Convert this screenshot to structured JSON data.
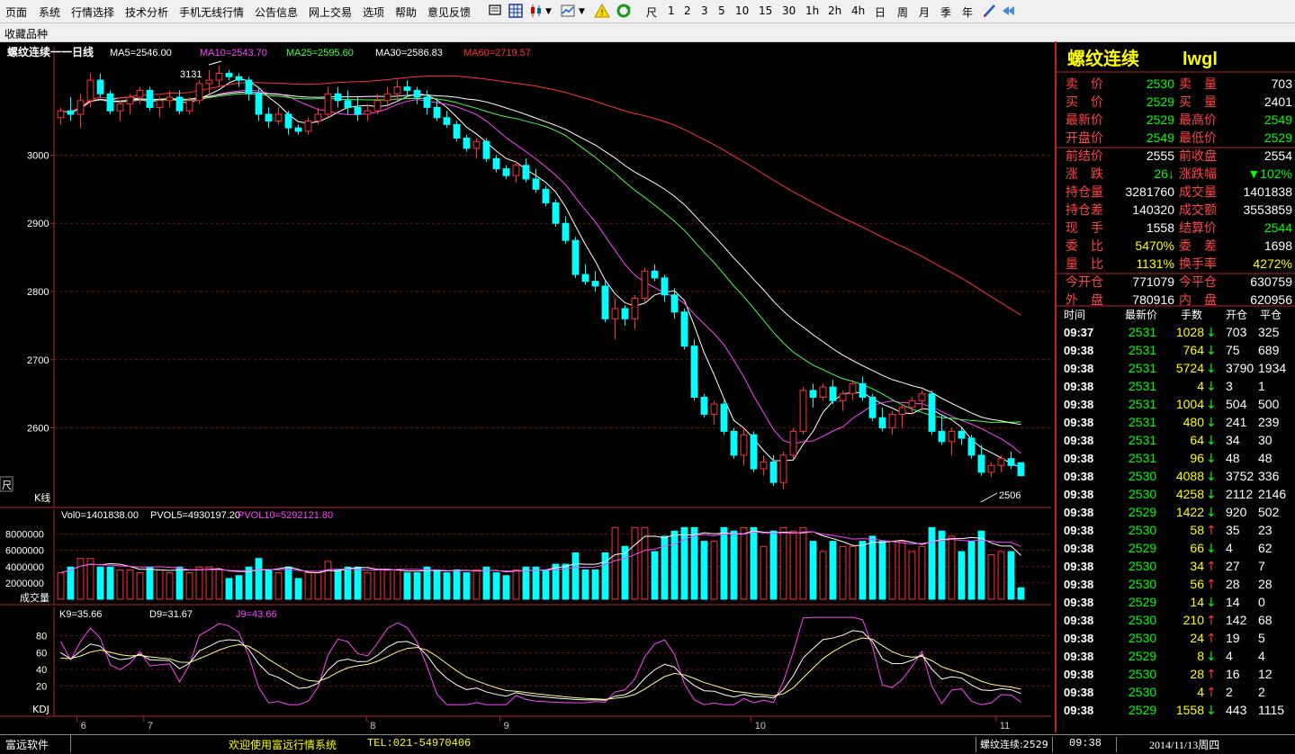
{
  "menu": [
    "页面",
    "系统",
    "行情选择",
    "技术分析",
    "手机无线行情",
    "公告信息",
    "网上交易",
    "选项",
    "帮助",
    "意见反馈"
  ],
  "toolbar": {
    "periods": [
      "尺",
      "1",
      "2",
      "3",
      "5",
      "10",
      "15",
      "30",
      "1h",
      "2h",
      "4h",
      "日",
      "周",
      "月",
      "季",
      "年"
    ]
  },
  "favorites_label": "收藏品种",
  "chart": {
    "title": "螺纹连续一一日线",
    "ma_labels": [
      {
        "text": "MA5=2546.00",
        "color": "#ffffff"
      },
      {
        "text": "MA10=2543.70",
        "color": "#ff44ff"
      },
      {
        "text": "MA25=2595.60",
        "color": "#44ff44"
      },
      {
        "text": "MA30=2586.83",
        "color": "#ffffff"
      },
      {
        "text": "MA60=2719.57",
        "color": "#ff3333"
      }
    ],
    "price_axis": [
      "3000",
      "2900",
      "2800",
      "2700",
      "2600"
    ],
    "high_label": "3131",
    "low_label": "2506",
    "k_label": "K线",
    "side_label": "尺",
    "vol_labels": [
      {
        "text": "Vol0=1401838.00",
        "color": "#ffffff"
      },
      {
        "text": "PVOL5=4930197.20",
        "color": "#ffffff"
      },
      {
        "text": "PVOL10=5292121.80",
        "color": "#ff44ff"
      }
    ],
    "vol_axis": [
      "8000000",
      "6000000",
      "4000000",
      "2000000"
    ],
    "vol_title": "成交量",
    "kdj_labels": [
      {
        "text": "K9=35.66",
        "color": "#ffffff"
      },
      {
        "text": "D9=31.67",
        "color": "#ffffff"
      },
      {
        "text": "J9=43.66",
        "color": "#ff44ff"
      }
    ],
    "kdj_axis": [
      "80",
      "60",
      "40",
      "20"
    ],
    "kdj_title": "KDJ",
    "date_axis": [
      "6",
      "7",
      "8",
      "9",
      "10",
      "11"
    ]
  },
  "chart_data": {
    "type": "candlestick",
    "title": "螺纹连续一一日线",
    "ylim": [
      2506,
      3131
    ],
    "candles": [
      [
        3055,
        3070,
        3045,
        3065
      ],
      [
        3065,
        3085,
        3050,
        3060
      ],
      [
        3060,
        3090,
        3040,
        3080
      ],
      [
        3080,
        3120,
        3070,
        3110
      ],
      [
        3110,
        3120,
        3085,
        3090
      ],
      [
        3090,
        3095,
        3060,
        3065
      ],
      [
        3065,
        3080,
        3050,
        3075
      ],
      [
        3075,
        3090,
        3060,
        3085
      ],
      [
        3085,
        3100,
        3075,
        3095
      ],
      [
        3095,
        3100,
        3065,
        3070
      ],
      [
        3070,
        3085,
        3055,
        3080
      ],
      [
        3080,
        3095,
        3070,
        3085
      ],
      [
        3085,
        3095,
        3060,
        3065
      ],
      [
        3065,
        3085,
        3060,
        3080
      ],
      [
        3080,
        3110,
        3075,
        3105
      ],
      [
        3105,
        3125,
        3090,
        3110
      ],
      [
        3110,
        3131,
        3100,
        3120
      ],
      [
        3120,
        3125,
        3110,
        3115
      ],
      [
        3115,
        3120,
        3100,
        3110
      ],
      [
        3110,
        3115,
        3080,
        3090
      ],
      [
        3090,
        3100,
        3050,
        3060
      ],
      [
        3060,
        3070,
        3040,
        3050
      ],
      [
        3050,
        3070,
        3045,
        3060
      ],
      [
        3060,
        3065,
        3030,
        3040
      ],
      [
        3040,
        3045,
        3030,
        3035
      ],
      [
        3035,
        3055,
        3030,
        3050
      ],
      [
        3050,
        3070,
        3045,
        3060
      ],
      [
        3060,
        3100,
        3055,
        3090
      ],
      [
        3090,
        3100,
        3070,
        3080
      ],
      [
        3080,
        3095,
        3060,
        3070
      ],
      [
        3070,
        3085,
        3050,
        3060
      ],
      [
        3060,
        3075,
        3050,
        3065
      ],
      [
        3065,
        3090,
        3060,
        3080
      ],
      [
        3080,
        3100,
        3070,
        3090
      ],
      [
        3090,
        3110,
        3080,
        3100
      ],
      [
        3100,
        3110,
        3085,
        3095
      ],
      [
        3095,
        3100,
        3075,
        3085
      ],
      [
        3085,
        3095,
        3060,
        3070
      ],
      [
        3070,
        3080,
        3050,
        3055
      ],
      [
        3055,
        3065,
        3040,
        3045
      ],
      [
        3045,
        3050,
        3020,
        3025
      ],
      [
        3025,
        3030,
        3005,
        3010
      ],
      [
        3010,
        3025,
        2995,
        3020
      ],
      [
        3020,
        3025,
        2990,
        2995
      ],
      [
        2995,
        3000,
        2975,
        2980
      ],
      [
        2980,
        2985,
        2965,
        2970
      ],
      [
        2970,
        2990,
        2960,
        2985
      ],
      [
        2985,
        2995,
        2960,
        2965
      ],
      [
        2965,
        2980,
        2945,
        2950
      ],
      [
        2950,
        2955,
        2925,
        2930
      ],
      [
        2930,
        2935,
        2895,
        2900
      ],
      [
        2900,
        2910,
        2870,
        2875
      ],
      [
        2875,
        2880,
        2820,
        2825
      ],
      [
        2825,
        2840,
        2810,
        2815
      ],
      [
        2815,
        2830,
        2800,
        2808
      ],
      [
        2808,
        2815,
        2755,
        2760
      ],
      [
        2760,
        2790,
        2730,
        2775
      ],
      [
        2775,
        2780,
        2750,
        2760
      ],
      [
        2760,
        2795,
        2745,
        2790
      ],
      [
        2790,
        2835,
        2785,
        2830
      ],
      [
        2830,
        2840,
        2815,
        2820
      ],
      [
        2820,
        2825,
        2785,
        2795
      ],
      [
        2795,
        2805,
        2760,
        2770
      ],
      [
        2770,
        2775,
        2715,
        2720
      ],
      [
        2720,
        2730,
        2640,
        2645
      ],
      [
        2645,
        2650,
        2615,
        2620
      ],
      [
        2620,
        2640,
        2605,
        2635
      ],
      [
        2635,
        2640,
        2590,
        2595
      ],
      [
        2595,
        2600,
        2555,
        2560
      ],
      [
        2560,
        2600,
        2545,
        2590
      ],
      [
        2590,
        2595,
        2535,
        2540
      ],
      [
        2540,
        2560,
        2530,
        2550
      ],
      [
        2550,
        2560,
        2515,
        2520
      ],
      [
        2520,
        2565,
        2510,
        2560
      ],
      [
        2560,
        2600,
        2555,
        2595
      ],
      [
        2595,
        2660,
        2590,
        2655
      ],
      [
        2655,
        2665,
        2630,
        2645
      ],
      [
        2645,
        2665,
        2640,
        2660
      ],
      [
        2660,
        2670,
        2635,
        2640
      ],
      [
        2640,
        2655,
        2625,
        2650
      ],
      [
        2650,
        2670,
        2640,
        2665
      ],
      [
        2665,
        2675,
        2640,
        2645
      ],
      [
        2645,
        2650,
        2610,
        2615
      ],
      [
        2615,
        2630,
        2595,
        2600
      ],
      [
        2600,
        2625,
        2590,
        2620
      ],
      [
        2620,
        2635,
        2600,
        2630
      ],
      [
        2630,
        2645,
        2620,
        2640
      ],
      [
        2640,
        2655,
        2625,
        2650
      ],
      [
        2650,
        2655,
        2590,
        2595
      ],
      [
        2595,
        2620,
        2575,
        2580
      ],
      [
        2580,
        2600,
        2560,
        2595
      ],
      [
        2595,
        2600,
        2575,
        2585
      ],
      [
        2585,
        2590,
        2555,
        2560
      ],
      [
        2560,
        2575,
        2530,
        2535
      ],
      [
        2535,
        2550,
        2528,
        2545
      ],
      [
        2545,
        2560,
        2535,
        2555
      ],
      [
        2555,
        2565,
        2540,
        2545
      ],
      [
        2549,
        2549,
        2529,
        2530
      ]
    ],
    "ma": {
      "MA5": 2546.0,
      "MA10": 2543.7,
      "MA25": 2595.6,
      "MA30": 2586.83,
      "MA60": 2719.57
    },
    "volume": {
      "Vol0": 1401838.0,
      "PVOL5": 4930197.2,
      "PVOL10": 5292121.8
    },
    "kdj": {
      "K9": 35.66,
      "D9": 31.67,
      "J9": 43.66
    }
  },
  "quote": {
    "title": "螺纹连续",
    "code": "lwgl",
    "rows": [
      [
        {
          "l": "卖　价",
          "v": "2530",
          "vc": "#00ff00"
        },
        {
          "l": "卖　量",
          "v": "703",
          "vc": "#ffffff"
        }
      ],
      [
        {
          "l": "买　价",
          "v": "2529",
          "vc": "#00ff00"
        },
        {
          "l": "买　量",
          "v": "2401",
          "vc": "#ffffff"
        }
      ],
      [
        {
          "l": "最新价",
          "v": "2529",
          "vc": "#00ff00"
        },
        {
          "l": "最高价",
          "v": "2549",
          "vc": "#00ff00"
        }
      ],
      [
        {
          "l": "开盘价",
          "v": "2549",
          "vc": "#00ff00"
        },
        {
          "l": "最低价",
          "v": "2529",
          "vc": "#00ff00"
        }
      ],
      [
        {
          "l": "前结价",
          "v": "2555",
          "vc": "#ffffff"
        },
        {
          "l": "前收盘",
          "v": "2554",
          "vc": "#ffffff"
        }
      ],
      [
        {
          "l": "涨　跌",
          "v": "26↓",
          "vc": "#00ff00"
        },
        {
          "l": "涨跌幅",
          "v": "▼102%",
          "vc": "#00ff00"
        }
      ],
      [
        {
          "l": "持仓量",
          "v": "3281760",
          "vc": "#ffffff"
        },
        {
          "l": "成交量",
          "v": "1401838",
          "vc": "#ffffff"
        }
      ],
      [
        {
          "l": "持仓差",
          "v": "140320",
          "vc": "#ffffff"
        },
        {
          "l": "成交额",
          "v": "3553859",
          "vc": "#ffffff"
        }
      ],
      [
        {
          "l": "现　手",
          "v": "1558",
          "vc": "#ffffff"
        },
        {
          "l": "结算价",
          "v": "2544",
          "vc": "#00ff00"
        }
      ],
      [
        {
          "l": "委　比",
          "v": "5470%",
          "vc": "#ffff00"
        },
        {
          "l": "委　差",
          "v": "1698",
          "vc": "#ffffff"
        }
      ],
      [
        {
          "l": "量　比",
          "v": "1131%",
          "vc": "#ffff00"
        },
        {
          "l": "换手率",
          "v": "4272%",
          "vc": "#ffff00"
        }
      ],
      [
        {
          "l": "今开仓",
          "v": "771079",
          "vc": "#ffffff"
        },
        {
          "l": "今平仓",
          "v": "630759",
          "vc": "#ffffff"
        }
      ],
      [
        {
          "l": "外　盘",
          "v": "780916",
          "vc": "#ffffff"
        },
        {
          "l": "内　盘",
          "v": "620956",
          "vc": "#ffffff"
        }
      ]
    ]
  },
  "ticks": {
    "headers": [
      "时间",
      "最新价",
      "手数",
      "开仓",
      "平仓"
    ],
    "rows": [
      [
        "09:37",
        "2531",
        "1028",
        "↓",
        "703",
        "325"
      ],
      [
        "09:38",
        "2531",
        "764",
        "↓",
        "75",
        "689"
      ],
      [
        "09:38",
        "2531",
        "5724",
        "↓",
        "3790",
        "1934"
      ],
      [
        "09:38",
        "2531",
        "4",
        "↓",
        "3",
        "1"
      ],
      [
        "09:38",
        "2531",
        "1004",
        "↓",
        "504",
        "500"
      ],
      [
        "09:38",
        "2531",
        "480",
        "↓",
        "241",
        "239"
      ],
      [
        "09:38",
        "2531",
        "64",
        "↓",
        "34",
        "30"
      ],
      [
        "09:38",
        "2531",
        "96",
        "↓",
        "48",
        "48"
      ],
      [
        "09:38",
        "2530",
        "4088",
        "↓",
        "3752",
        "336"
      ],
      [
        "09:38",
        "2530",
        "4258",
        "↓",
        "2112",
        "2146"
      ],
      [
        "09:38",
        "2529",
        "1422",
        "↓",
        "920",
        "502"
      ],
      [
        "09:38",
        "2530",
        "58",
        "↑",
        "35",
        "23"
      ],
      [
        "09:38",
        "2529",
        "66",
        "↓",
        "4",
        "62"
      ],
      [
        "09:38",
        "2530",
        "34",
        "↑",
        "27",
        "7"
      ],
      [
        "09:38",
        "2530",
        "56",
        "↑",
        "28",
        "28"
      ],
      [
        "09:38",
        "2529",
        "14",
        "↓",
        "14",
        "0"
      ],
      [
        "09:38",
        "2530",
        "210",
        "↑",
        "142",
        "68"
      ],
      [
        "09:38",
        "2530",
        "24",
        "↑",
        "19",
        "5"
      ],
      [
        "09:38",
        "2529",
        "8",
        "↓",
        "4",
        "4"
      ],
      [
        "09:38",
        "2530",
        "28",
        "↑",
        "16",
        "12"
      ],
      [
        "09:38",
        "2530",
        "4",
        "↑",
        "2",
        "2"
      ],
      [
        "09:38",
        "2529",
        "1558",
        "↓",
        "443",
        "1115"
      ]
    ]
  },
  "status": {
    "brand": "富远软件",
    "welcome": "欢迎使用富远行情系统",
    "tel": "TEL:021-54970406",
    "symbol": "螺纹连续:2529",
    "time": "09:38",
    "date": "2014/11/13周四"
  },
  "colors": {
    "up": "#ff3333",
    "down": "#00ffff",
    "grid": "#7a1010",
    "axis": "#b22222"
  }
}
